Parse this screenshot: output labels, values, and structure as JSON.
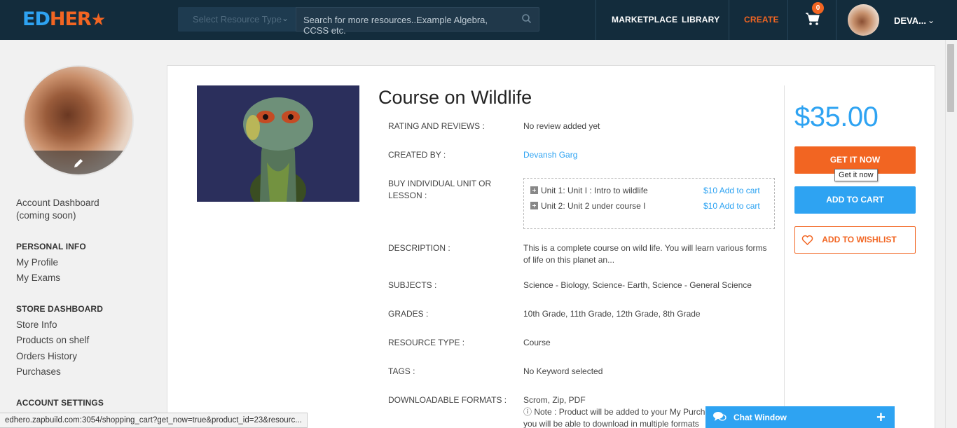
{
  "header": {
    "logo_ed": "ED",
    "logo_hero": "HER",
    "resource_type_placeholder": "Select Resource Type",
    "search_placeholder": "Search for more resources..Example Algebra, CCSS etc.",
    "nav": {
      "marketplace": "MARKETPLACE",
      "library": "LIBRARY",
      "create": "CREATE"
    },
    "cart_count": "0",
    "user_name": "DEVA..."
  },
  "sidebar": {
    "account_dashboard": "Account Dashboard",
    "account_dashboard_note": "(coming soon)",
    "personal_info_heading": "PERSONAL INFO",
    "my_profile": "My Profile",
    "my_exams": "My Exams",
    "store_dashboard_heading": "STORE DASHBOARD",
    "store_info": "Store Info",
    "products_on_shelf": "Products on shelf",
    "orders_history": "Orders History",
    "purchases": "Purchases",
    "account_settings_heading": "ACCOUNT SETTINGS"
  },
  "course": {
    "title": "Course on Wildlife",
    "labels": {
      "rating": "RATING AND REVIEWS :",
      "created_by": "CREATED BY :",
      "buy_individual_1": "BUY INDIVIDUAL UNIT OR",
      "buy_individual_2": "LESSON :",
      "description": "DESCRIPTION :",
      "subjects": "SUBJECTS :",
      "grades": "GRADES :",
      "resource_type": "RESOURCE TYPE :",
      "tags": "TAGS :",
      "downloadable_formats": "DOWNLOADABLE FORMATS :"
    },
    "rating_value": "No review added yet",
    "creator": "Devansh Garg",
    "units": [
      {
        "name": "Unit 1: Unit I : Intro to wildlife",
        "price": "$10 Add to cart"
      },
      {
        "name": "Unit 2: Unit 2 under course I",
        "price": "$10 Add to cart"
      }
    ],
    "description_1": "This is a complete course on wild life. You will learn various forms",
    "description_2": "of life on this planet an...",
    "subjects": "Science - Biology, Science- Earth, Science - General Science",
    "grades": "10th Grade, 11th Grade, 12th Grade, 8th Grade",
    "resource_type": "Course",
    "tags": "No Keyword selected",
    "formats": "Scrom, Zip, PDF",
    "note_1": "Note : Product will be added to your My Purch",
    "note_2": "you will be able to download in multiple formats"
  },
  "purchase": {
    "price": "$35.00",
    "get_it_now": "GET IT NOW",
    "tooltip": "Get it now",
    "add_to_cart": "ADD TO CART",
    "add_to_wishlist": "ADD TO WISHLIST"
  },
  "status_bar": {
    "url": "edhero.zapbuild.com:3054/shopping_cart?get_now=true&product_id=23&resourc..."
  },
  "chat": {
    "label": "Chat Window",
    "plus": "+"
  },
  "colors": {
    "header_bg": "#132c3c",
    "accent_orange": "#f26522",
    "accent_blue": "#2ea3f2"
  }
}
